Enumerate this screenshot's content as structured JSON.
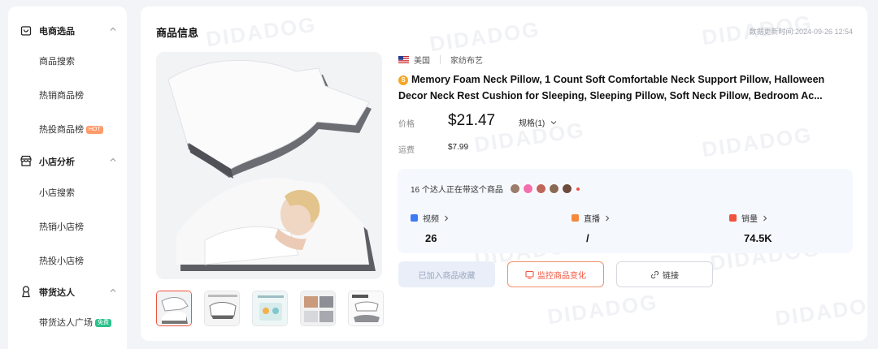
{
  "sidebar": {
    "groups": [
      {
        "label": "电商选品",
        "icon": "shopping-bag-icon",
        "items": [
          {
            "label": "商品搜索"
          },
          {
            "label": "热销商品榜"
          },
          {
            "label": "热投商品榜",
            "badge": "HOT"
          }
        ]
      },
      {
        "label": "小店分析",
        "icon": "store-icon",
        "items": [
          {
            "label": "小店搜索"
          },
          {
            "label": "热销小店榜"
          },
          {
            "label": "热投小店榜"
          }
        ]
      },
      {
        "label": "带货达人",
        "icon": "user-icon",
        "items": [
          {
            "label": "带货达人广场",
            "badge": "免费"
          }
        ]
      }
    ]
  },
  "watermark": "DIDADOG",
  "main": {
    "section_title": "商品信息",
    "update_time": "数据更新时间:2024-09-26 12:54",
    "product": {
      "country": "美国",
      "category": "家纺布艺",
      "title": "Memory Foam Neck Pillow, 1 Count Soft Comfortable Neck Support Pillow, Halloween Decor Neck Rest Cushion for Sleeping, Sleeping Pillow, Soft Neck Pillow, Bedroom Ac...",
      "price_label": "价格",
      "price": "$21.47",
      "spec": "规格(1)",
      "shipping_label": "运费",
      "shipping": "$7.99"
    },
    "kol_card": {
      "text": "16 个达人正在带这个商品",
      "stats": [
        {
          "label": "视频",
          "value": "26",
          "color": "#3d7bf5"
        },
        {
          "label": "直播",
          "value": "/",
          "color": "#f58a3d"
        },
        {
          "label": "销量",
          "value": "74.5K",
          "color": "#f0533d"
        }
      ]
    },
    "buttons": {
      "favorite": "已加入商品收藏",
      "monitor": "监控商品变化",
      "link": "链接"
    }
  },
  "colors": {
    "accent": "#f0533d",
    "blue": "#3d7bf5",
    "page_bg": "#f3f4f7"
  }
}
